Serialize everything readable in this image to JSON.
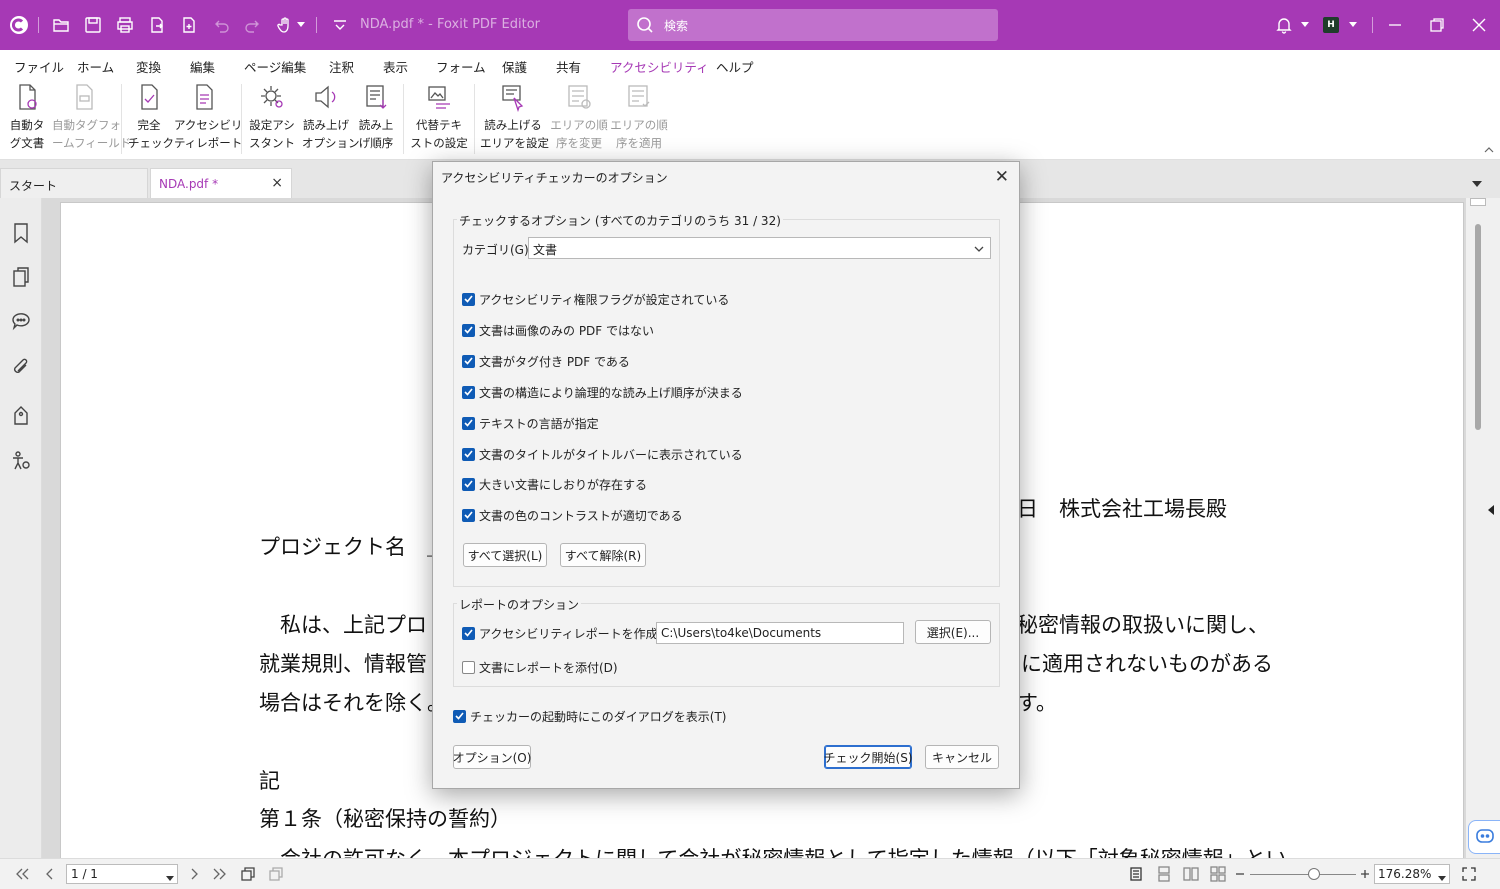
{
  "app": {
    "title": "NDA.pdf * - Foxit PDF Editor",
    "search_placeholder": "検索",
    "user_initial": "H",
    "accent_color": "#a639b5"
  },
  "menu": {
    "tabs": [
      "ファイル",
      "ホーム",
      "変換",
      "編集",
      "ページ編集",
      "注釈",
      "表示",
      "フォーム",
      "保護",
      "共有",
      "アクセシビリティ",
      "ヘルプ"
    ],
    "active": "アクセシビリティ"
  },
  "ribbon": {
    "buttons": [
      {
        "line1": "自動タ",
        "line2": "グ文書",
        "icon": "auto-tag-document-icon",
        "enabled": true
      },
      {
        "line1": "自動タグフォ",
        "line2": "ームフィールド",
        "icon": "auto-tag-form-field-icon",
        "enabled": false
      },
      {
        "line1": "完全",
        "line2": "チェック",
        "icon": "full-check-icon",
        "enabled": true
      },
      {
        "line1": "アクセシビリ",
        "line2": "ティレポート",
        "icon": "accessibility-report-icon",
        "enabled": true
      },
      {
        "line1": "設定アシ",
        "line2": "スタント",
        "icon": "setup-assistant-icon",
        "enabled": true
      },
      {
        "line1": "読み上げ",
        "line2": "オプション",
        "icon": "read-out-loud-options-icon",
        "enabled": true
      },
      {
        "line1": "読み上",
        "line2": "げ順序",
        "icon": "reading-order-icon",
        "enabled": true
      },
      {
        "line1": "代替テキ",
        "line2": "ストの設定",
        "icon": "alternate-text-icon",
        "enabled": true
      },
      {
        "line1": "読み上げる",
        "line2": "エリアを設定",
        "icon": "set-reading-area-icon",
        "enabled": true
      },
      {
        "line1": "エリアの順",
        "line2": "序を変更",
        "icon": "change-area-order-icon",
        "enabled": false
      },
      {
        "line1": "エリアの順",
        "line2": "序を適用",
        "icon": "apply-area-order-icon",
        "enabled": false
      }
    ]
  },
  "doc_tabs": [
    {
      "label": "スタート",
      "active": false
    },
    {
      "label": "NDA.pdf *",
      "active": true
    }
  ],
  "document": {
    "lines": {
      "project_name": "プロジェクト名　＿",
      "header_right": "日　株式会社工場長殿",
      "p1_left": "　私は、上記プロ",
      "p1_right": "秘密情報の取扱いに関し、",
      "p2_left": "就業規則、情報管",
      "p2_right": "に適用されないものがある",
      "p3_left": "場合はそれを除く。",
      "p3_right": "す。",
      "ki": "記",
      "article1": "第１条（秘密保持の誓約）",
      "article1_body": "　会社の許可なく、本プロジェクトに関して会社が秘密情報として指定した情報（以下「対象秘密情報」とい"
    }
  },
  "dialog": {
    "title": "アクセシビリティチェッカーのオプション",
    "check_group_label": "チェックするオプション (すべてのカテゴリのうち 31 / 32)",
    "category_label": "カテゴリ(G):",
    "category_value": "文書",
    "checks": [
      {
        "label": "アクセシビリティ権限フラグが設定されている",
        "checked": true
      },
      {
        "label": "文書は画像のみの PDF ではない",
        "checked": true
      },
      {
        "label": "文書がタグ付き PDF である",
        "checked": true
      },
      {
        "label": "文書の構造により論理的な読み上げ順序が決まる",
        "checked": true
      },
      {
        "label": "テキストの言語が指定",
        "checked": true
      },
      {
        "label": "文書のタイトルがタイトルバーに表示されている",
        "checked": true
      },
      {
        "label": "大きい文書にしおりが存在する",
        "checked": true
      },
      {
        "label": "文書の色のコントラストが適切である",
        "checked": true
      }
    ],
    "select_all": "すべて選択(L)",
    "deselect_all": "すべて解除(R)",
    "report_group_label": "レポートのオプション",
    "create_report_label": "アクセシビリティレポートを作成(B)",
    "create_report_checked": true,
    "report_path": "C:\\Users\\to4ke\\Documents",
    "browse_button": "選択(E)...",
    "attach_report_label": "文書にレポートを添付(D)",
    "attach_report_checked": false,
    "show_dialog_label": "チェッカーの起動時にこのダイアログを表示(T)",
    "show_dialog_checked": true,
    "options_button": "オプション(O)",
    "start_button": "チェック開始(S)",
    "cancel_button": "キャンセル"
  },
  "status": {
    "page": "1 / 1",
    "zoom": "176.28%"
  }
}
